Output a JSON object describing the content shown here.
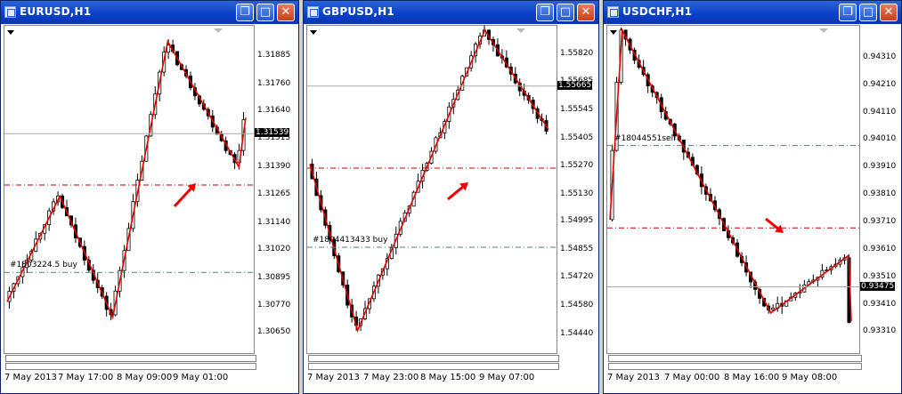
{
  "windows": [
    {
      "title": "EURUSD,H1",
      "price_labels": [
        "1.31885",
        "1.31760",
        "1.31640",
        "1.31515",
        "1.31390",
        "1.31265",
        "1.31140",
        "1.31020",
        "1.30895",
        "1.30770",
        "1.30650"
      ],
      "current_price": "1.31539",
      "order_label": "#1803224.5 buy",
      "date_labels": [
        "7 May 2013",
        "7 May 17:00",
        "8 May 09:00",
        "9 May 01:00"
      ],
      "y_range": [
        1.3058,
        1.32
      ]
    },
    {
      "title": "GBPUSD,H1",
      "price_labels": [
        "1.55820",
        "1.55685",
        "1.55545",
        "1.55405",
        "1.55270",
        "1.55130",
        "1.54995",
        "1.54855",
        "1.54720",
        "1.54580",
        "1.54440"
      ],
      "current_price": "1.55665",
      "order_label": "#1804413433 buy",
      "date_labels": [
        "7 May 2013",
        "7 May 23:00",
        "8 May 15:00",
        "9 May 07:00"
      ],
      "y_range": [
        1.5437,
        1.5594
      ]
    },
    {
      "title": "USDCHF,H1",
      "price_labels": [
        "0.94310",
        "0.94210",
        "0.94110",
        "0.94010",
        "0.93910",
        "0.93810",
        "0.93710",
        "0.93610",
        "0.93510",
        "0.93410",
        "0.93310"
      ],
      "current_price": "0.93475",
      "order_label": "#18044551sell",
      "date_labels": [
        "7 May 2013",
        "7 May 00:00",
        "8 May 16:00",
        "9 May 08:00"
      ],
      "y_range": [
        0.9325,
        0.9441
      ]
    }
  ],
  "window_buttons": {
    "restore": "❐",
    "maximize": "□",
    "close": "✕"
  },
  "chart_data": [
    {
      "type": "candlestick",
      "title": "EURUSD,H1",
      "x_ticks": [
        "7 May 2013",
        "7 May 17:00",
        "8 May 09:00",
        "9 May 01:00"
      ],
      "ylim": [
        1.3065,
        1.3195
      ],
      "current_price": 1.31539,
      "zigzag": [
        {
          "x": 0,
          "y": 1.3079
        },
        {
          "x": 23,
          "y": 1.3126
        },
        {
          "x": 46,
          "y": 1.3072
        },
        {
          "x": 70,
          "y": 1.3195
        },
        {
          "x": 101,
          "y": 1.3139
        },
        {
          "x": 104,
          "y": 1.3161
        }
      ],
      "levels": [
        {
          "y": 1.3131,
          "style": "dash-dot",
          "color": "#cc0000"
        },
        {
          "y": 1.3092,
          "style": "dash-dot",
          "color": "#4a8a6a",
          "label": "#1803224.5 buy"
        }
      ],
      "arrow_color": "#ee0000"
    },
    {
      "type": "candlestick",
      "title": "GBPUSD,H1",
      "x_ticks": [
        "7 May 2013",
        "7 May 23:00",
        "8 May 15:00",
        "9 May 07:00"
      ],
      "ylim": [
        1.5444,
        1.5582
      ],
      "current_price": 1.55665,
      "zigzag": [
        {
          "x": 0,
          "y": 1.5528
        },
        {
          "x": 18,
          "y": 1.5446
        },
        {
          "x": 66,
          "y": 1.5594
        },
        {
          "x": 90,
          "y": 1.5545
        }
      ],
      "levels": [
        {
          "y": 1.5526,
          "style": "dash-dot",
          "color": "#cc0000"
        },
        {
          "y": 1.5487,
          "style": "dash-dot",
          "color": "#4a8a6a",
          "label": "#1804413433 buy"
        }
      ],
      "arrow_color": "#ee0000"
    },
    {
      "type": "candlestick",
      "title": "USDCHF,H1",
      "x_ticks": [
        "7 May 2013",
        "7 May 00:00",
        "8 May 16:00",
        "9 May 08:00"
      ],
      "ylim": [
        0.9331,
        0.9431
      ],
      "current_price": 0.93475,
      "zigzag": [
        {
          "x": 0,
          "y": 0.9372
        },
        {
          "x": 5,
          "y": 0.9441
        },
        {
          "x": 66,
          "y": 0.9338
        },
        {
          "x": 98,
          "y": 0.9359
        },
        {
          "x": 99,
          "y": 0.9335
        }
      ],
      "levels": [
        {
          "y": 0.9399,
          "style": "dash-dot",
          "color": "#4a8a6a",
          "label": "#18044551sell"
        },
        {
          "y": 0.9369,
          "style": "dash-dot",
          "color": "#cc0000"
        }
      ],
      "arrow_color": "#ee0000"
    }
  ]
}
